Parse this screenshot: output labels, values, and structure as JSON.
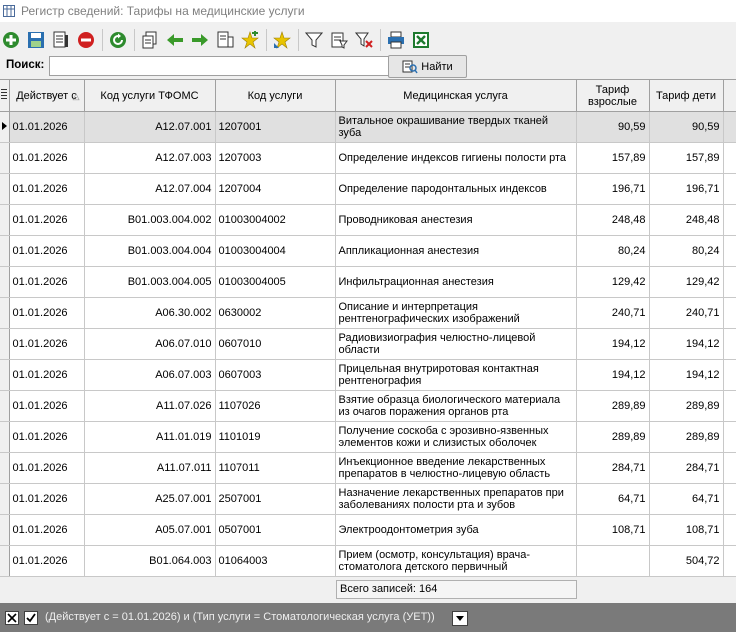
{
  "window": {
    "title": "Регистр сведений: Тарифы на медицинские услуги"
  },
  "toolbar": {
    "buttons": [
      {
        "icon": "add-icon",
        "color": "#2e8b2e"
      },
      {
        "icon": "save-icon",
        "color": "#2a6fb0"
      },
      {
        "icon": "properties-icon",
        "color": "#333333"
      },
      {
        "icon": "delete-icon",
        "color": "#d02020"
      },
      {
        "icon": "refresh-icon",
        "color": "#2e8b2e"
      },
      {
        "icon": "copy-icon",
        "color": "#333333"
      },
      {
        "icon": "arrow-left-icon",
        "color": "#3a9a2a"
      },
      {
        "icon": "arrow-right-icon",
        "color": "#3a9a2a"
      },
      {
        "icon": "copy-records-icon",
        "color": "#333333"
      },
      {
        "icon": "add-star-icon",
        "color": "#e8c400"
      },
      {
        "icon": "favorite-icon",
        "color": "#e8c400"
      },
      {
        "icon": "filter-icon",
        "color": "#333333"
      },
      {
        "icon": "edit-filter-icon",
        "color": "#333333"
      },
      {
        "icon": "clear-filter-icon",
        "color": "#d02020"
      },
      {
        "icon": "print-icon",
        "color": "#2a6fb0"
      },
      {
        "icon": "excel-export-icon",
        "color": "#1e7a2e"
      }
    ]
  },
  "search": {
    "label": "Поиск:",
    "value": "",
    "button_label": "Найти"
  },
  "table": {
    "columns": [
      "Действует с",
      "Код услуги ТФОМС",
      "Код услуги",
      "Медицинская услуга",
      "Тариф взрослые",
      "Тариф дети"
    ],
    "rows": [
      {
        "date": "01.01.2026",
        "tfoms": "A12.07.001",
        "code": "1207001",
        "service": "Витальное окрашивание твердых тканей зуба",
        "adult": "90,59",
        "child": "90,59"
      },
      {
        "date": "01.01.2026",
        "tfoms": "A12.07.003",
        "code": "1207003",
        "service": "Определение индексов гигиены полости рта",
        "adult": "157,89",
        "child": "157,89"
      },
      {
        "date": "01.01.2026",
        "tfoms": "A12.07.004",
        "code": "1207004",
        "service": "Определение пародонтальных индексов",
        "adult": "196,71",
        "child": "196,71"
      },
      {
        "date": "01.01.2026",
        "tfoms": "B01.003.004.002",
        "code": "01003004002",
        "service": "Проводниковая анестезия",
        "adult": "248,48",
        "child": "248,48"
      },
      {
        "date": "01.01.2026",
        "tfoms": "B01.003.004.004",
        "code": "01003004004",
        "service": "Аппликационная анестезия",
        "adult": "80,24",
        "child": "80,24"
      },
      {
        "date": "01.01.2026",
        "tfoms": "B01.003.004.005",
        "code": "01003004005",
        "service": "Инфильтрационная анестезия",
        "adult": "129,42",
        "child": "129,42"
      },
      {
        "date": "01.01.2026",
        "tfoms": "A06.30.002",
        "code": "0630002",
        "service": "Описание и интерпретация рентгенографических изображений",
        "adult": "240,71",
        "child": "240,71"
      },
      {
        "date": "01.01.2026",
        "tfoms": "A06.07.010",
        "code": "0607010",
        "service": "Радиовизиография челюстно-лицевой области",
        "adult": "194,12",
        "child": "194,12"
      },
      {
        "date": "01.01.2026",
        "tfoms": "A06.07.003",
        "code": "0607003",
        "service": "Прицельная внутриротовая контактная рентгенография",
        "adult": "194,12",
        "child": "194,12"
      },
      {
        "date": "01.01.2026",
        "tfoms": "A11.07.026",
        "code": "1107026",
        "service": "Взятие образца биологического материала из очагов поражения органов рта",
        "adult": "289,89",
        "child": "289,89"
      },
      {
        "date": "01.01.2026",
        "tfoms": "A11.01.019",
        "code": "1101019",
        "service": "Получение соскоба с эрозивно-язвенных элементов кожи и слизистых оболочек",
        "adult": "289,89",
        "child": "289,89"
      },
      {
        "date": "01.01.2026",
        "tfoms": "A11.07.011",
        "code": "1107011",
        "service": "Инъекционное введение лекарственных препаратов в челюстно-лицевую область",
        "adult": "284,71",
        "child": "284,71"
      },
      {
        "date": "01.01.2026",
        "tfoms": "A25.07.001",
        "code": "2507001",
        "service": "Назначение лекарственных препаратов при заболеваниях полости рта и зубов",
        "adult": "64,71",
        "child": "64,71"
      },
      {
        "date": "01.01.2026",
        "tfoms": "A05.07.001",
        "code": "0507001",
        "service": "Электроодонтометрия зуба",
        "adult": "108,71",
        "child": "108,71"
      },
      {
        "date": "01.01.2026",
        "tfoms": "B01.064.003",
        "code": "01064003",
        "service": "Прием (осмотр, консультация) врача-стоматолога детского первичный",
        "adult": "",
        "child": "504,72"
      }
    ]
  },
  "status": {
    "total_records": "Всего записей: 164"
  },
  "filterbar": {
    "text": "(Действует с = 01.01.2026) и (Тип услуги = Стоматологическая услуга (УЕТ))"
  }
}
